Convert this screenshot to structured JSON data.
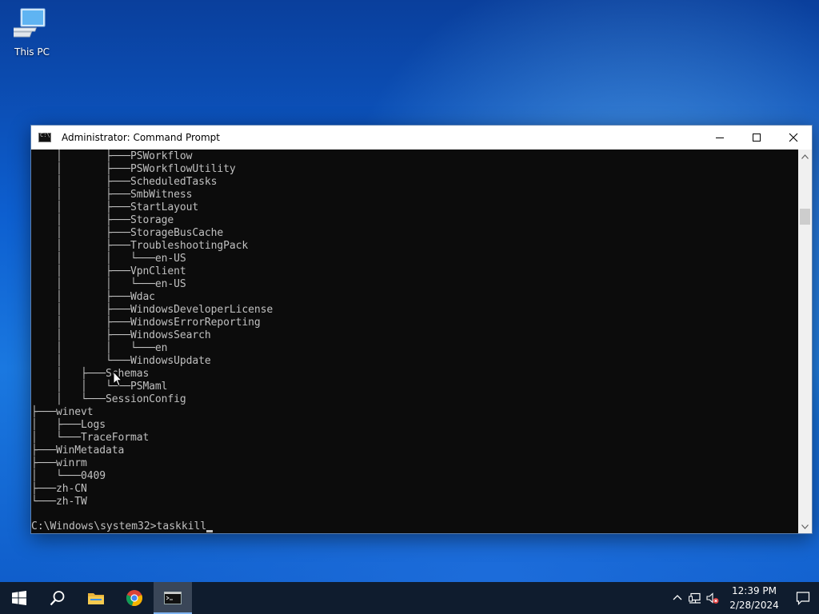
{
  "desktop": {
    "icons": [
      {
        "label": "This PC",
        "icon": "this-pc-icon"
      }
    ]
  },
  "window": {
    "title": "Administrator: Command Prompt",
    "app_icon": "cmd-icon",
    "controls": {
      "minimize": "minimize-icon",
      "maximize": "maximize-icon",
      "close": "close-icon"
    }
  },
  "console": {
    "lines": [
      "    │       ├───PSWorkflow",
      "    │       ├───PSWorkflowUtility",
      "    │       ├───ScheduledTasks",
      "    │       ├───SmbWitness",
      "    │       ├───StartLayout",
      "    │       ├───Storage",
      "    │       ├───StorageBusCache",
      "    │       ├───TroubleshootingPack",
      "    │       │   └───en-US",
      "    │       ├───VpnClient",
      "    │       │   └───en-US",
      "    │       ├───Wdac",
      "    │       ├───WindowsDeveloperLicense",
      "    │       ├───WindowsErrorReporting",
      "    │       ├───WindowsSearch",
      "    │       │   └───en",
      "    │       └───WindowsUpdate",
      "    │   ├───Schemas",
      "    │   │   └───PSMaml",
      "    │   └───SessionConfig",
      "├───winevt",
      "│   ├───Logs",
      "│   └───TraceFormat",
      "├───WinMetadata",
      "├───winrm",
      "│   └───0409",
      "├───zh-CN",
      "└───zh-TW"
    ],
    "prompt": "C:\\Windows\\system32>",
    "input": "taskkill"
  },
  "taskbar": {
    "items": [
      {
        "name": "start-button",
        "icon": "windows-logo-icon"
      },
      {
        "name": "search-button",
        "icon": "search-icon"
      },
      {
        "name": "file-explorer-button",
        "icon": "folder-icon"
      },
      {
        "name": "chrome-button",
        "icon": "chrome-icon"
      },
      {
        "name": "command-prompt-button",
        "icon": "cmd-icon",
        "active": true
      }
    ],
    "tray": {
      "icons": [
        "chevron-up-icon",
        "network-icon",
        "volume-muted-icon"
      ],
      "time": "12:39 PM",
      "date": "2/28/2024",
      "notification_icon": "notification-icon"
    }
  }
}
